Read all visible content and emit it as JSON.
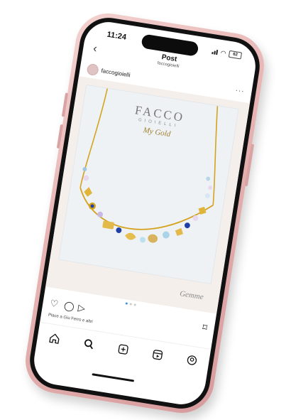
{
  "status_bar": {
    "time": "11:24",
    "battery": "62"
  },
  "header": {
    "title": "Post",
    "subtitle": "faccogioielli"
  },
  "account": {
    "name": "faccogioielli"
  },
  "post": {
    "brand": "FACCO",
    "brand_sub": "GIOIELLI",
    "collection": "My Gold",
    "signature": "Gemme",
    "carousel_pages": 3,
    "carousel_active": 1
  },
  "caption": {
    "text": "Piace a Giu Ferro e altri"
  },
  "icons": {
    "back": "chevron-left-icon",
    "more": "ellipsis-icon",
    "like": "heart-icon",
    "comment": "comment-icon",
    "share": "send-icon",
    "save": "bookmark-icon",
    "home": "home-icon",
    "search": "search-icon",
    "create": "plus-square-icon",
    "reels": "reels-icon",
    "profile": "profile-icon"
  },
  "colors": {
    "phone_case": "#e7b6b5",
    "gold": "#d4a21c",
    "sapphire": "#1f3fa8",
    "carousel_active": "#3a8ee6"
  }
}
